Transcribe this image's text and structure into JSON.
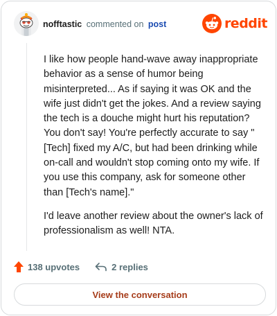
{
  "header": {
    "username": "nofftastic",
    "verb": "commented on",
    "post_link": "post",
    "brand_name": "reddit",
    "avatar_icon": "snoo-avatar-icon",
    "logo_icon": "reddit-logo-icon"
  },
  "comment": {
    "paragraphs": [
      "I like how people hand-wave away inappropriate behavior as a sense of humor being misinterpreted... As if saying it was OK and the wife just didn't get the jokes. And a review saying the tech is a douche might hurt his reputation? You don't say! You're perfectly accurate to say \"[Tech] fixed my A/C, but had been drinking while on-call and wouldn't stop coming onto my wife. If you use this company, ask for someone other than [Tech's name].\"",
      "I'd leave another review about the owner's lack of professionalism as well! NTA."
    ]
  },
  "actions": {
    "upvotes": "138 upvotes",
    "replies": "2 replies",
    "upvote_icon": "upvote-arrow-icon",
    "reply_icon": "reply-arrow-icon"
  },
  "footer": {
    "button_label": "View the conversation"
  },
  "colors": {
    "brand": "#ff4500",
    "link": "#1a4bb1",
    "muted": "#576f76",
    "button_text": "#a63c1a"
  }
}
